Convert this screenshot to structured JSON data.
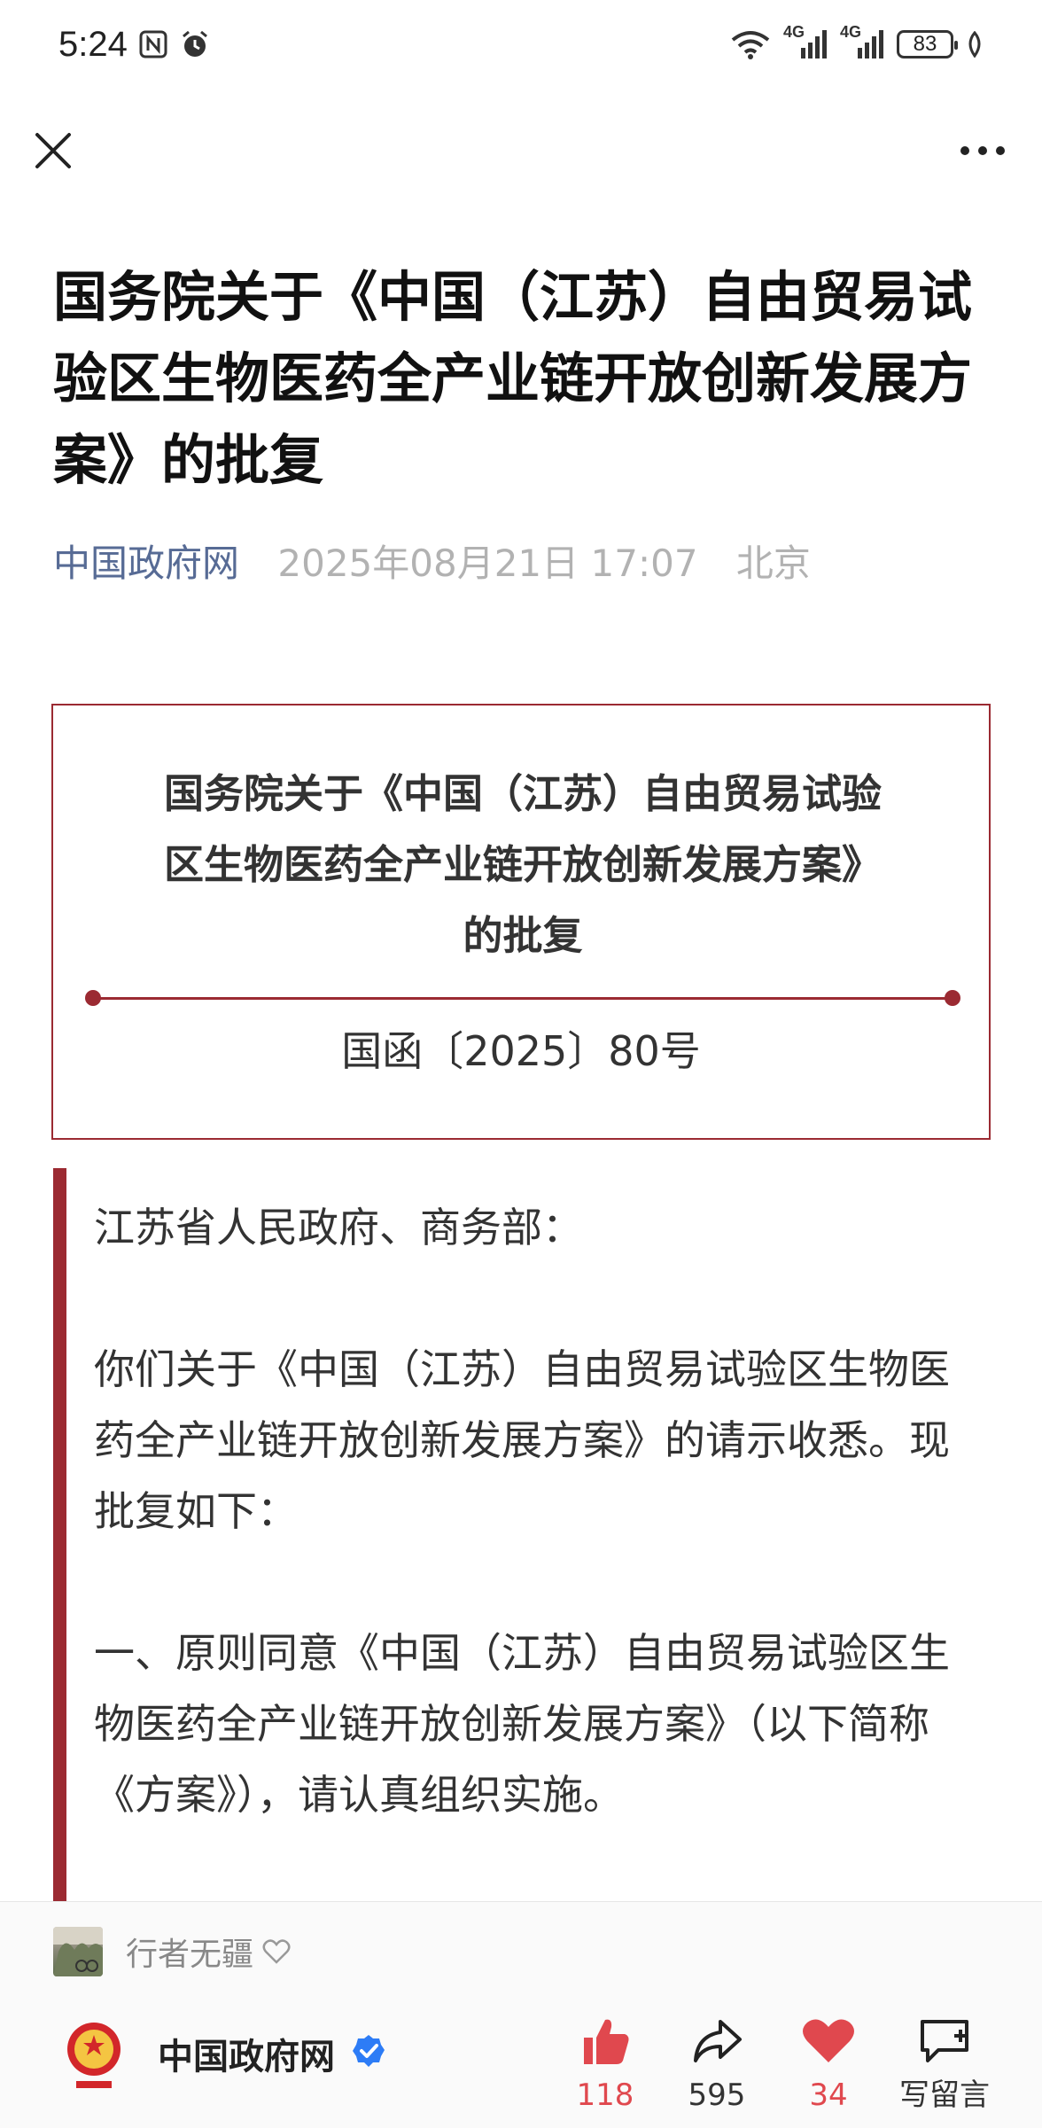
{
  "status_bar": {
    "time": "5:24",
    "battery": "83",
    "network_1": "4G",
    "network_2": "4G"
  },
  "top_bar": {
    "close_icon": "close-icon",
    "more_icon": "more-icon"
  },
  "article": {
    "title": "国务院关于《中国（江苏）自由贸易试验区生物医药全产业链开放创新发展方案》的批复",
    "source": "中国政府网",
    "datetime": "2025年08月21日 17:07",
    "location": "北京"
  },
  "document_box": {
    "title": "国务院关于《中国（江苏）自由贸易试验区生物医药全产业链开放创新发展方案》的批复",
    "number": "国函〔2025〕80号",
    "accent_color": "#9b2a32"
  },
  "body": {
    "paragraphs": [
      "江苏省人民政府、商务部：",
      "你们关于《中国（江苏）自由贸易试验区生物医药全产业链开放创新发展方案》的请示收悉。现批复如下：",
      "一、原则同意《中国（江苏）自由贸易试验区生物医药全产业链开放创新发展方案》（以下简称《方案》），请认真组织实施。"
    ]
  },
  "bottom_sheet": {
    "commenter_name": "行者无疆",
    "publisher_name": "中国政府网",
    "like_count": "118",
    "share_count": "595",
    "favorite_count": "34",
    "write_comment_label": "写留言"
  }
}
